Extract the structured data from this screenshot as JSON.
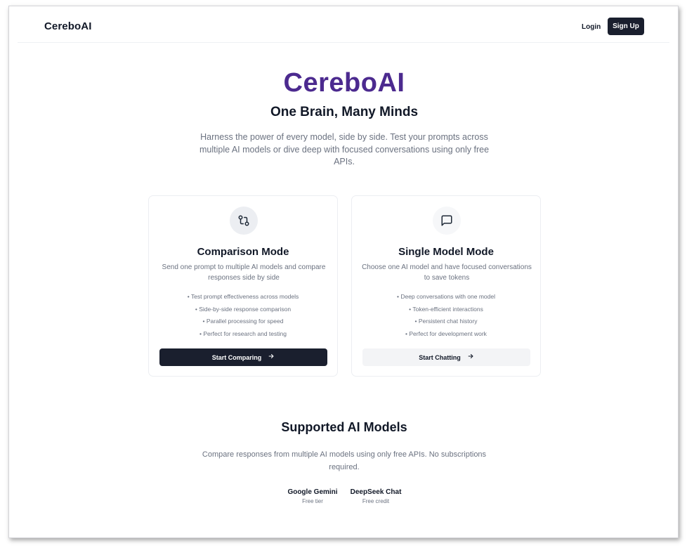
{
  "header": {
    "brand": "CereboAI",
    "login_label": "Login",
    "signup_label": "Sign Up"
  },
  "hero": {
    "title": "CereboAI",
    "subtitle": "One Brain, Many Minds",
    "description": "Harness the power of every model, side by side. Test your prompts across multiple AI models or dive deep with focused conversations using only free APIs."
  },
  "cards": [
    {
      "icon": "git-compare-icon",
      "title": "Comparison Mode",
      "description": "Send one prompt to multiple AI models and compare responses side by side",
      "features": [
        "• Test prompt effectiveness across models",
        "• Side-by-side response comparison",
        "• Parallel processing for speed",
        "• Perfect for research and testing"
      ],
      "button_label": "Start Comparing",
      "button_icon": "arrow-right-icon"
    },
    {
      "icon": "chat-bubble-icon",
      "title": "Single Model Mode",
      "description": "Choose one AI model and have focused conversations to save tokens",
      "features": [
        "• Deep conversations with one model",
        "• Token-efficient interactions",
        "• Persistent chat history",
        "• Perfect for development work"
      ],
      "button_label": "Start Chatting",
      "button_icon": "arrow-right-icon"
    }
  ],
  "models_section": {
    "title": "Supported AI Models",
    "description": "Compare responses from multiple AI models using only free APIs. No subscriptions required.",
    "models": [
      {
        "name": "Google Gemini",
        "note": "Free tier"
      },
      {
        "name": "DeepSeek Chat",
        "note": "Free credit"
      }
    ]
  },
  "colors": {
    "brand_purple": "#4c2a8f",
    "primary_dark": "#1a1f2e",
    "muted_text": "#6b7280"
  }
}
